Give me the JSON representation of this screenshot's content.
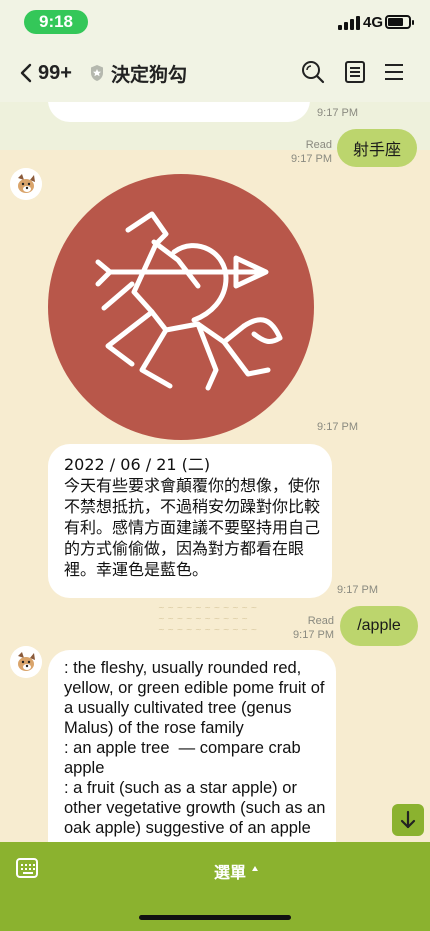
{
  "status_bar": {
    "time": "9:18",
    "network": "4G"
  },
  "header": {
    "back_count": "99+",
    "title": "決定狗勾"
  },
  "messages": {
    "top_time": "9:17 PM",
    "sent1": {
      "text": "射手座",
      "read": "Read",
      "time": "9:17 PM"
    },
    "sticker_time": "9:17 PM",
    "horoscope": {
      "text": "2022 / 06 / 21 (二)\n今天有些要求會顛覆你的想像，使你不禁想抵抗，不過稍安勿躁對你比較有利。感情方面建議不要堅持用自己的方式偷偷做，因為對方都看在眼裡。幸運色是藍色。",
      "time": "9:17 PM"
    },
    "sent2": {
      "text": "/apple",
      "read": "Read",
      "time": "9:17 PM"
    },
    "definition": {
      "text": ": the fleshy, usually rounded red, yellow, or green edible pome fruit of a usually cultivated tree (genus Malus) of the rose family\n: an apple tree  — compare crab apple\n: a fruit (such as a star apple) or other vegetative growth (such as an oak apple) suggestive of an apple"
    }
  },
  "menu": {
    "label": "選單"
  },
  "colors": {
    "accent_green": "#8bb22f",
    "bubble_green": "#bcd56d",
    "sticker_red": "#b8574a",
    "chat_bg": "#f7ecd0"
  }
}
